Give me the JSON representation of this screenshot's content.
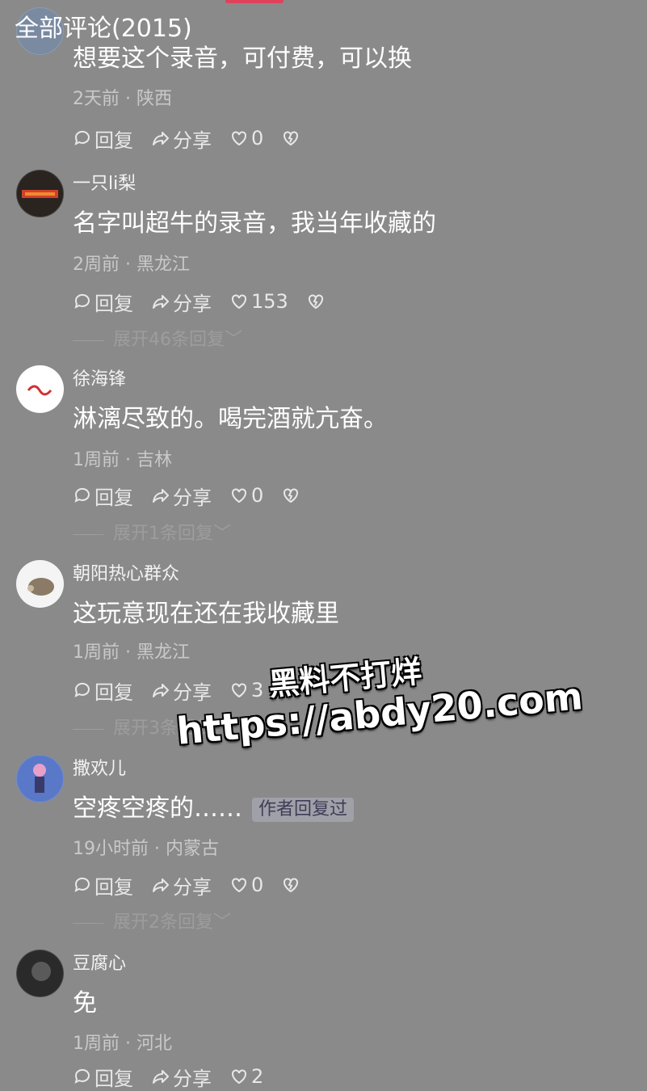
{
  "header": {
    "title": "全部评论(2015)"
  },
  "comments": [
    {
      "username": "",
      "content": "想要这个录音，可付费，可以换",
      "meta": "2天前 · 陕西",
      "reply_label": "回复",
      "share_label": "分享",
      "likes": "0",
      "expand": ""
    },
    {
      "username": "一只li梨",
      "content": "名字叫超牛的录音，我当年收藏的",
      "meta": "2周前 · 黑龙江",
      "reply_label": "回复",
      "share_label": "分享",
      "likes": "153",
      "expand": "展开46条回复"
    },
    {
      "username": "徐海锋",
      "content": "淋漓尽致的。喝完酒就亢奋。",
      "meta": "1周前 · 吉林",
      "reply_label": "回复",
      "share_label": "分享",
      "likes": "0",
      "expand": "展开1条回复"
    },
    {
      "username": "朝阳热心群众",
      "content": "这玩意现在还在我收藏里",
      "meta": "1周前 · 黑龙江",
      "reply_label": "回复",
      "share_label": "分享",
      "likes": "3",
      "expand": "展开3条回复"
    },
    {
      "username": "撒欢儿",
      "content": "空疼空疼的……",
      "badge": "作者回复过",
      "meta": "19小时前 · 内蒙古",
      "reply_label": "回复",
      "share_label": "分享",
      "likes": "0",
      "expand": "展开2条回复"
    },
    {
      "username": "豆腐心",
      "content": "免",
      "meta": "1周前 · 河北",
      "reply_label": "回复",
      "share_label": "分享",
      "likes": "2",
      "expand": ""
    }
  ],
  "watermark": {
    "line1": "黑料不打烊",
    "line2": "https://abdy20.com"
  },
  "colors": {
    "background": "#8a8a8a",
    "accent": "#e0415a",
    "badge_bg": "#a0a0a8"
  }
}
